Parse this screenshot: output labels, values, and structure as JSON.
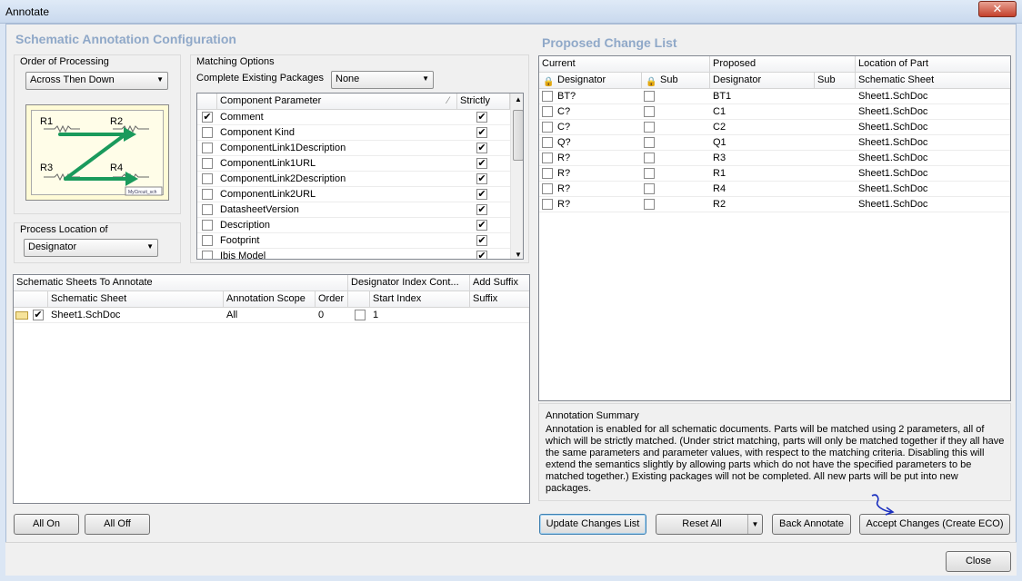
{
  "window": {
    "title": "Annotate",
    "close_glyph": "✕"
  },
  "left": {
    "title": "Schematic Annotation Configuration",
    "order": {
      "label": "Order of Processing",
      "value": "Across Then Down"
    },
    "matching": {
      "label": "Matching Options",
      "packages_label": "Complete Existing Packages",
      "packages_value": "None",
      "col_param": "Component Parameter",
      "col_strict": "Strictly",
      "params": [
        {
          "name": "Comment",
          "checked": true,
          "strict": true
        },
        {
          "name": "Component Kind",
          "checked": false,
          "strict": true
        },
        {
          "name": "ComponentLink1Description",
          "checked": false,
          "strict": true
        },
        {
          "name": "ComponentLink1URL",
          "checked": false,
          "strict": true
        },
        {
          "name": "ComponentLink2Description",
          "checked": false,
          "strict": true
        },
        {
          "name": "ComponentLink2URL",
          "checked": false,
          "strict": true
        },
        {
          "name": "DatasheetVersion",
          "checked": false,
          "strict": true
        },
        {
          "name": "Description",
          "checked": false,
          "strict": true
        },
        {
          "name": "Footprint",
          "checked": false,
          "strict": true
        },
        {
          "name": "Ibis Model",
          "checked": false,
          "strict": true
        }
      ]
    },
    "process": {
      "label": "Process Location of",
      "value": "Designator"
    },
    "diagram": {
      "r1": "R1",
      "r2": "R2",
      "r3": "R3",
      "r4": "R4",
      "stamp": "MyCircuit_sch"
    },
    "sheets": {
      "group1": "Schematic Sheets To Annotate",
      "group2": "Designator Index Cont...",
      "group3": "Add Suffix",
      "col_sheet": "Schematic Sheet",
      "col_scope": "Annotation Scope",
      "col_order": "Order",
      "col_start": "Start Index",
      "col_suffix": "Suffix",
      "rows": [
        {
          "sheet": "Sheet1.SchDoc",
          "scope": "All",
          "order": "0",
          "start": "1",
          "suffix": ""
        }
      ]
    },
    "btn_all_on": "All On",
    "btn_all_off": "All Off"
  },
  "right": {
    "title": "Proposed Change List",
    "group_current": "Current",
    "group_proposed": "Proposed",
    "group_location": "Location of Part",
    "col_designator": "Designator",
    "col_sub": "Sub",
    "col_sheet": "Schematic Sheet",
    "rows": [
      {
        "cur": "BT?",
        "new": "BT1",
        "sheet": "Sheet1.SchDoc"
      },
      {
        "cur": "C?",
        "new": "C1",
        "sheet": "Sheet1.SchDoc"
      },
      {
        "cur": "C?",
        "new": "C2",
        "sheet": "Sheet1.SchDoc"
      },
      {
        "cur": "Q?",
        "new": "Q1",
        "sheet": "Sheet1.SchDoc"
      },
      {
        "cur": "R?",
        "new": "R3",
        "sheet": "Sheet1.SchDoc"
      },
      {
        "cur": "R?",
        "new": "R1",
        "sheet": "Sheet1.SchDoc"
      },
      {
        "cur": "R?",
        "new": "R4",
        "sheet": "Sheet1.SchDoc"
      },
      {
        "cur": "R?",
        "new": "R2",
        "sheet": "Sheet1.SchDoc"
      }
    ],
    "summary_title": "Annotation Summary",
    "summary_text": "Annotation is enabled for all schematic documents. Parts will be matched using 2 parameters, all of which will be strictly matched. (Under strict matching, parts will only be matched together if they all have the same parameters and parameter values, with respect to the matching criteria. Disabling this will extend the semantics slightly by allowing parts which do not have the specified parameters to be matched together.) Existing packages will not be completed. All new parts will be put into new packages.",
    "btn_update": "Update Changes List",
    "btn_reset": "Reset All",
    "btn_back": "Back Annotate",
    "btn_accept": "Accept Changes (Create ECO)"
  },
  "btn_close": "Close"
}
